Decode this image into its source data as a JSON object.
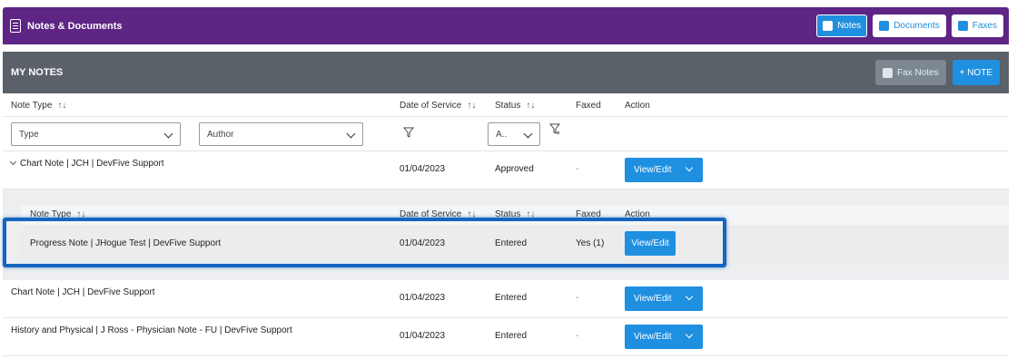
{
  "header": {
    "title": "Notes & Documents",
    "buttons": [
      {
        "label": "Notes",
        "active": true,
        "icon": "notes-icon"
      },
      {
        "label": "Documents",
        "active": false,
        "icon": "documents-icon"
      },
      {
        "label": "Faxes",
        "active": false,
        "icon": "faxes-icon"
      }
    ]
  },
  "section": {
    "title": "MY NOTES",
    "fax_notes_label": "Fax Notes",
    "add_note_label": "+ NOTE"
  },
  "columns": {
    "note_type": "Note Type",
    "date_of_service": "Date of Service",
    "status": "Status",
    "faxed": "Faxed",
    "action": "Action",
    "sort_glyph": "↑↓"
  },
  "filters": {
    "type": "Type",
    "author": "Author",
    "status": "A.."
  },
  "rows": [
    {
      "note": "Chart Note | JCH | DevFive Support",
      "date": "01/04/2023",
      "status": "Approved",
      "faxed": "-",
      "action": "View/Edit"
    },
    {
      "note": "Chart Note | JCH | DevFive Support",
      "date": "01/04/2023",
      "status": "Entered",
      "faxed": "-",
      "action": "View/Edit"
    },
    {
      "note": "History and Physical | J Ross - Physician Note - FU | DevFive Support",
      "date": "01/04/2023",
      "status": "Entered",
      "faxed": "-",
      "action": "View/Edit"
    }
  ],
  "nested": {
    "columns": {
      "note_type": "Note Type",
      "date_of_service": "Date of Service",
      "status": "Status",
      "faxed": "Faxed",
      "action": "Action",
      "sort_glyph": "↑↓"
    },
    "row": {
      "note": "Progress Note | JHogue Test | DevFive Support",
      "date": "01/04/2023",
      "status": "Entered",
      "faxed": "Yes (1)",
      "action": "View/Edit"
    }
  },
  "colors": {
    "header_purple": "#5e2584",
    "section_gray": "#5a6168",
    "accent_blue": "#1f8fe0",
    "highlight_blue": "#1565c0"
  }
}
